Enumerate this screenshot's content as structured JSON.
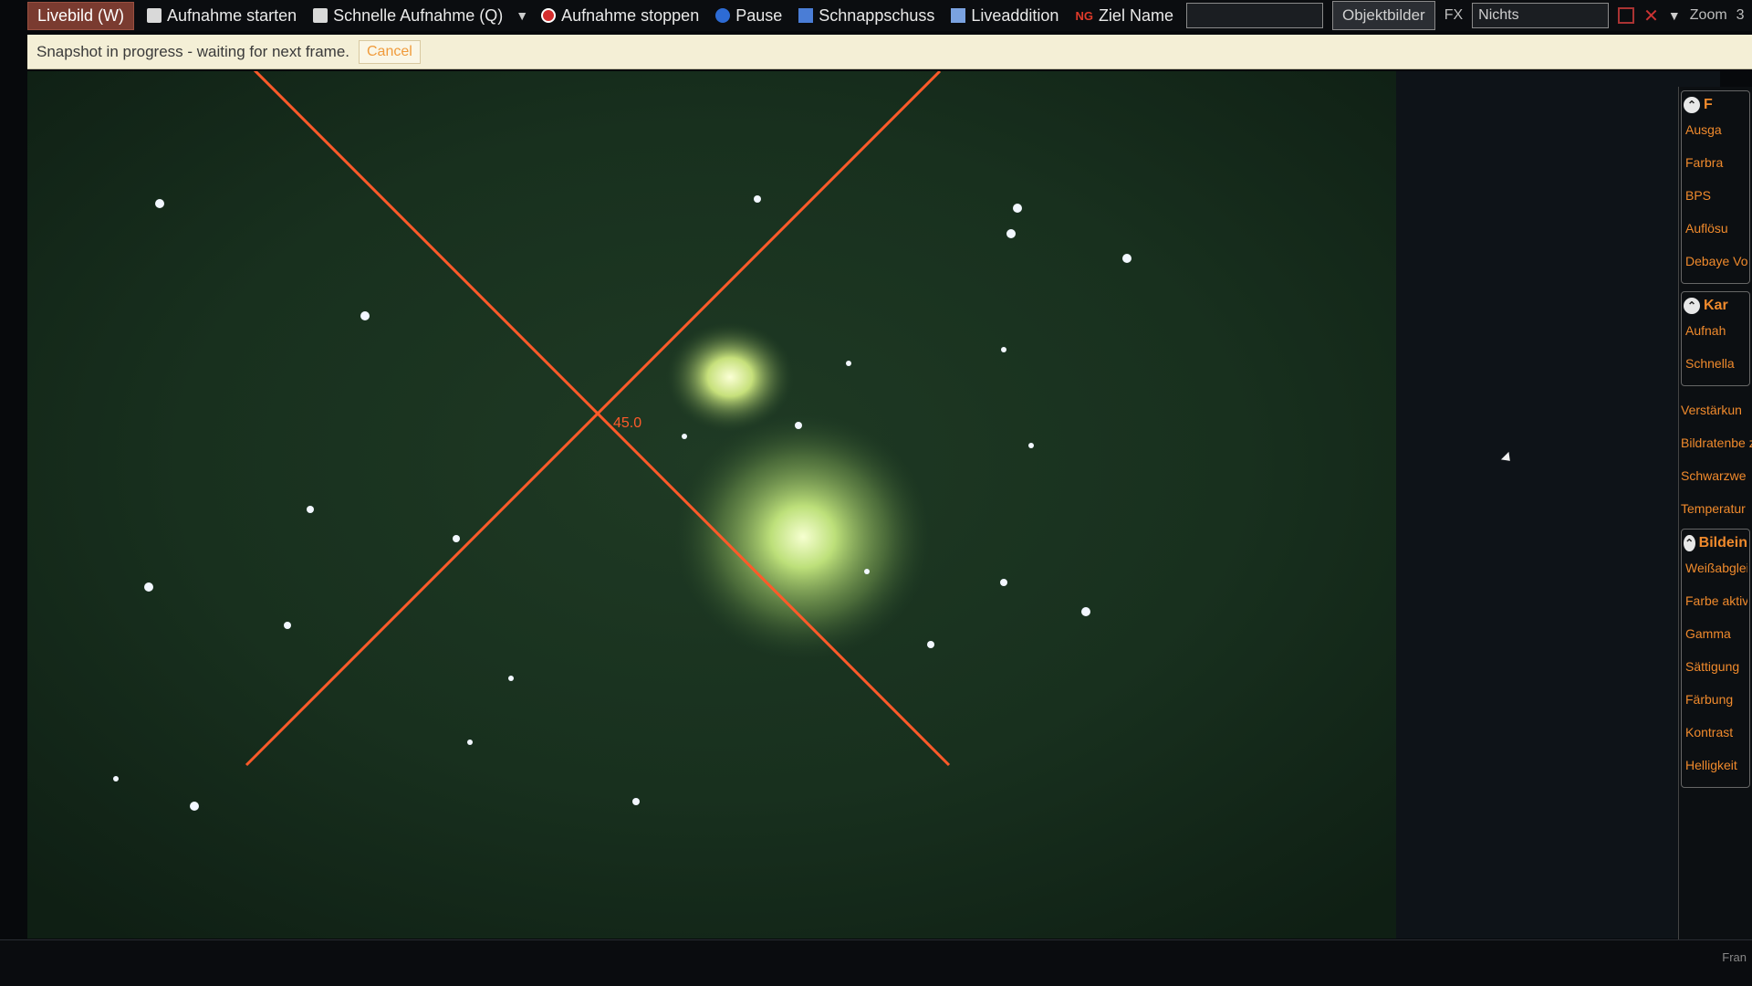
{
  "toolbar": {
    "live_button": "Livebild (W)",
    "start_record": "Aufnahme starten",
    "quick_record": "Schnelle Aufnahme (Q)",
    "stop_record": "Aufnahme stoppen",
    "pause": "Pause",
    "snapshot": "Schnappschuss",
    "live_addition": "Liveaddition",
    "ng_badge": "NG",
    "target_name": "Ziel Name",
    "target_input_value": "",
    "object_images": "Objektbilder",
    "fx": "FX",
    "fx_value": "Nichts",
    "zoom": "Zoom",
    "zoom_value": "3"
  },
  "notice": {
    "message": "Snapshot in progress - waiting for next frame.",
    "cancel": "Cancel"
  },
  "image": {
    "crosshair_angle": "45.0",
    "crosshair_color": "#ff5a2a"
  },
  "side_panel": {
    "group1_title": "F",
    "group1_items": [
      "Ausga",
      "Farbra",
      "BPS",
      "Auflösu",
      "Debaye Voransi"
    ],
    "group2_title": "Kar",
    "group2_items": [
      "Aufnah",
      "Schnella"
    ],
    "items_mid": [
      "Verstärkun",
      "Bildratenbe zung",
      "Schwarzwe",
      "Temperatur"
    ],
    "group3_title": "Bildein",
    "group3_items": [
      "Weißabgleic",
      "Farbe aktivie",
      "Gamma",
      "Sättigung",
      "Färbung",
      "Kontrast",
      "Helligkeit"
    ]
  },
  "status": {
    "right_text": "Fran"
  }
}
